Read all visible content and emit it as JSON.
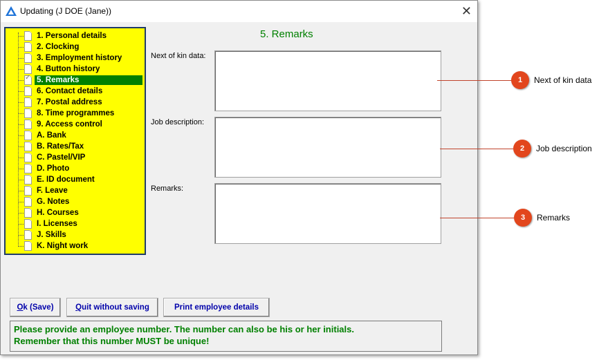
{
  "window": {
    "title": "Updating  (J DOE (Jane))"
  },
  "tree": {
    "items": [
      {
        "label": "1. Personal details",
        "checked": false
      },
      {
        "label": "2. Clocking",
        "checked": false
      },
      {
        "label": "3. Employment history",
        "checked": false
      },
      {
        "label": "4. Button history",
        "checked": false
      },
      {
        "label": "5. Remarks",
        "checked": true,
        "selected": true
      },
      {
        "label": "6. Contact details",
        "checked": false
      },
      {
        "label": "7. Postal address",
        "checked": false
      },
      {
        "label": "8. Time programmes",
        "checked": false
      },
      {
        "label": "9. Access control",
        "checked": false
      },
      {
        "label": "A. Bank",
        "checked": false
      },
      {
        "label": "B. Rates/Tax",
        "checked": false
      },
      {
        "label": "C. Pastel/VIP",
        "checked": false
      },
      {
        "label": "D. Photo",
        "checked": false
      },
      {
        "label": "E. ID document",
        "checked": false
      },
      {
        "label": "F. Leave",
        "checked": false
      },
      {
        "label": "G. Notes",
        "checked": false
      },
      {
        "label": "H. Courses",
        "checked": false
      },
      {
        "label": "I. Licenses",
        "checked": false
      },
      {
        "label": "J. Skills",
        "checked": false
      },
      {
        "label": "K. Night work",
        "checked": false
      }
    ]
  },
  "section": {
    "title": "5. Remarks"
  },
  "fields": {
    "next_of_kin": {
      "label": "Next of kin data:",
      "value": ""
    },
    "job_description": {
      "label": "Job description:",
      "value": ""
    },
    "remarks": {
      "label": "Remarks:",
      "value": ""
    }
  },
  "buttons": {
    "ok": {
      "hotkey": "O",
      "rest": "k (Save)"
    },
    "quit": {
      "hotkey": "Q",
      "rest": "uit without saving"
    },
    "print": {
      "label": "Print employee details"
    }
  },
  "status": {
    "line1": "Please provide an employee number. The number can also be his or her initials.",
    "line2": "Remember that this number MUST be unique!"
  },
  "callouts": [
    {
      "number": "1",
      "label": "Next of kin data"
    },
    {
      "number": "2",
      "label": "Job description"
    },
    {
      "number": "3",
      "label": "Remarks"
    }
  ],
  "colors": {
    "tree_background": "#ffff00",
    "selection": "#008000",
    "section_title": "#008000",
    "button_text": "#0000aa",
    "badge": "#e2461d"
  }
}
